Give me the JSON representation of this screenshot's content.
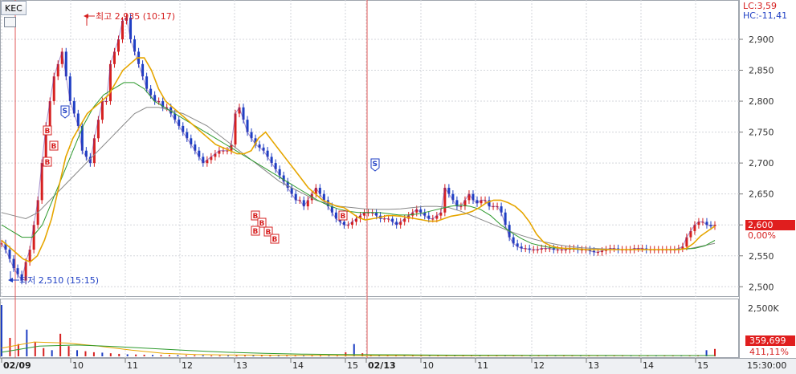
{
  "symbol": "KEC",
  "indicator_lc": "LC:3,59",
  "indicator_hc": "HC:-11,41",
  "current_price": "2,600",
  "current_change": "0,00%",
  "volume_current": "359,699",
  "volume_ratio": "411,11%",
  "volume_max_label": "2,500K",
  "high_marker": "최고 2,935 (10:17)",
  "low_marker": "최저 2,510 (15:15)",
  "time_label": "15:30:00",
  "price_ticks": [
    "2,900",
    "2,850",
    "2,800",
    "2,750",
    "2,700",
    "2,650",
    "2,600",
    "2,550",
    "2,500"
  ],
  "x_ticks": [
    "02/09",
    "10",
    "11",
    "12",
    "13",
    "14",
    "15",
    "02/13",
    "10",
    "11",
    "12",
    "13",
    "14",
    "15"
  ],
  "colors": {
    "up": "#d62020",
    "down": "#1f3fc4",
    "ma_short": "#e6a600",
    "ma_mid": "#2e9a2e",
    "ma_long": "#888888",
    "grid": "#d3d6db",
    "vline": "#e05a5a"
  },
  "chart_data": {
    "type": "line",
    "title": "KEC",
    "ylim": [
      2490,
      2935
    ],
    "price_path": [
      2570,
      2560,
      2545,
      2530,
      2520,
      2510,
      2540,
      2560,
      2600,
      2640,
      2700,
      2760,
      2800,
      2840,
      2860,
      2880,
      2840,
      2800,
      2780,
      2760,
      2720,
      2710,
      2700,
      2740,
      2770,
      2800,
      2800,
      2860,
      2880,
      2900,
      2930,
      2935,
      2900,
      2880,
      2860,
      2840,
      2820,
      2810,
      2800,
      2800,
      2790,
      2790,
      2780,
      2770,
      2760,
      2750,
      2740,
      2730,
      2720,
      2710,
      2700,
      2705,
      2710,
      2715,
      2720,
      2720,
      2720,
      2730,
      2780,
      2790,
      2770,
      2750,
      2740,
      2730,
      2725,
      2720,
      2710,
      2700,
      2690,
      2680,
      2670,
      2660,
      2650,
      2640,
      2640,
      2630,
      2640,
      2650,
      2660,
      2650,
      2640,
      2630,
      2620,
      2610,
      2605,
      2600,
      2600,
      2605,
      2610,
      2615,
      2620,
      2620,
      2620,
      2615,
      2610,
      2610,
      2610,
      2605,
      2600,
      2605,
      2610,
      2615,
      2620,
      2625,
      2620,
      2615,
      2610,
      2610,
      2615,
      2620,
      2660,
      2650,
      2640,
      2630,
      2630,
      2640,
      2650,
      2640,
      2635,
      2640,
      2640,
      2630,
      2630,
      2630,
      2620,
      2600,
      2580,
      2570,
      2565,
      2562,
      2562,
      2560,
      2560,
      2560,
      2562,
      2562,
      2562,
      2560,
      2560,
      2560,
      2560,
      2562,
      2562,
      2560,
      2560,
      2560,
      2558,
      2556,
      2556,
      2558,
      2560,
      2562,
      2562,
      2560,
      2560,
      2560,
      2560,
      2562,
      2562,
      2562,
      2560,
      2560,
      2560,
      2560,
      2560,
      2560,
      2560,
      2560,
      2562,
      2565,
      2580,
      2590,
      2600,
      2605,
      2605,
      2600,
      2598,
      2600
    ],
    "ma_short_path": [
      2575,
      2565,
      2555,
      2545,
      2540,
      2550,
      2575,
      2610,
      2660,
      2710,
      2740,
      2760,
      2780,
      2790,
      2800,
      2810,
      2830,
      2850,
      2860,
      2870,
      2870,
      2850,
      2820,
      2800,
      2790,
      2780,
      2770,
      2760,
      2750,
      2740,
      2730,
      2725,
      2720,
      2715,
      2715,
      2720,
      2740,
      2750,
      2735,
      2720,
      2705,
      2690,
      2675,
      2660,
      2650,
      2640,
      2635,
      2630,
      2628,
      2620,
      2612,
      2608,
      2610,
      2612,
      2615,
      2615,
      2614,
      2612,
      2610,
      2608,
      2606,
      2606,
      2610,
      2614,
      2616,
      2618,
      2622,
      2628,
      2636,
      2640,
      2640,
      2636,
      2630,
      2620,
      2605,
      2585,
      2572,
      2566,
      2563,
      2562,
      2562,
      2561,
      2560,
      2560,
      2560,
      2560,
      2560,
      2560,
      2560,
      2560,
      2560,
      2560,
      2560,
      2560,
      2560,
      2560,
      2562,
      2570,
      2582,
      2590,
      2598
    ],
    "ma_mid_path": [
      2600,
      2590,
      2580,
      2580,
      2600,
      2640,
      2680,
      2720,
      2760,
      2790,
      2810,
      2820,
      2830,
      2830,
      2820,
      2800,
      2790,
      2780,
      2770,
      2760,
      2750,
      2740,
      2730,
      2720,
      2710,
      2700,
      2690,
      2680,
      2670,
      2660,
      2650,
      2640,
      2632,
      2626,
      2622,
      2620,
      2620,
      2620,
      2618,
      2616,
      2616,
      2618,
      2622,
      2626,
      2630,
      2632,
      2630,
      2625,
      2615,
      2600,
      2588,
      2578,
      2570,
      2566,
      2563,
      2562,
      2561,
      2560,
      2560,
      2560,
      2560,
      2560,
      2560,
      2560,
      2560,
      2560,
      2560,
      2561,
      2562,
      2566,
      2575
    ],
    "ma_long_path": [
      2620,
      2615,
      2610,
      2620,
      2640,
      2660,
      2680,
      2700,
      2720,
      2740,
      2760,
      2780,
      2790,
      2790,
      2785,
      2780,
      2770,
      2760,
      2745,
      2730,
      2715,
      2700,
      2685,
      2670,
      2660,
      2650,
      2640,
      2634,
      2630,
      2628,
      2626,
      2625,
      2625,
      2626,
      2628,
      2630,
      2630,
      2628,
      2622,
      2614,
      2606,
      2598,
      2590,
      2583,
      2577,
      2572,
      2568,
      2565,
      2563,
      2562,
      2561,
      2560,
      2560,
      2560,
      2560,
      2560,
      2561,
      2562,
      2566,
      2570
    ],
    "volume_path": [
      2500,
      900,
      600,
      1300,
      700,
      400,
      300,
      1100,
      500,
      300,
      250,
      200,
      180,
      150,
      120,
      100,
      90,
      80,
      70,
      60,
      60,
      60,
      50,
      50,
      50,
      40,
      40,
      40,
      40,
      40,
      40,
      30,
      30,
      30,
      30,
      30,
      30,
      30,
      30,
      30,
      30,
      200,
      600,
      150,
      80,
      60,
      60,
      50,
      40,
      40,
      40,
      30,
      30,
      30,
      30,
      30,
      30,
      30,
      30,
      30,
      30,
      30,
      30,
      30,
      30,
      30,
      30,
      30,
      30,
      30,
      30,
      30,
      30,
      30,
      30,
      30,
      30,
      30,
      30,
      30,
      30,
      30,
      30,
      60,
      300,
      360
    ],
    "buy_signals": 9,
    "sell_signals": 2,
    "grid": true
  }
}
